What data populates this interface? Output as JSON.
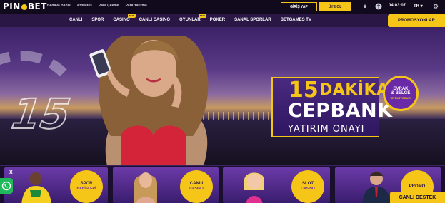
{
  "brand": {
    "logo_left": "PIN",
    "logo_right": "BET"
  },
  "top_links": [
    "Bedava Bahis",
    "Affiliates",
    "Para Çekme",
    "Para Yatırma"
  ],
  "auth": {
    "login": "GİRİŞ YAP",
    "register": "ÜYE OL"
  },
  "status": {
    "clock": "04:03:07",
    "lang": "TR"
  },
  "nav": [
    {
      "label": "CANLI",
      "badge": ""
    },
    {
      "label": "SPOR",
      "badge": ""
    },
    {
      "label": "CASINO",
      "badge": "NEW"
    },
    {
      "label": "CANLI CASINO",
      "badge": ""
    },
    {
      "label": "OYUNLAR",
      "badge": "NEW"
    },
    {
      "label": "POKER",
      "badge": ""
    },
    {
      "label": "SANAL SPORLAR",
      "badge": ""
    },
    {
      "label": "BETGAMES TV",
      "badge": ""
    }
  ],
  "promo_button": "PROMOSYONLAR",
  "hero": {
    "counter_digit": "15",
    "headline_number": "15",
    "headline_word": "DAKİKA",
    "brand_word": "CEPBANK",
    "sub": "YATIRIM ONAYI",
    "evrak_line1": "EVRAK",
    "evrak_line2": "& BELGE",
    "evrak_line3": "İSTEMİYORUZ!"
  },
  "cards": [
    {
      "line1": "SPOR",
      "line2": "BAHİSLERİ"
    },
    {
      "line1": "CANLI",
      "line2": "CASINO"
    },
    {
      "line1": "SLOT",
      "line2": "CASINO"
    },
    {
      "line1": "PROMO",
      "line2": ""
    }
  ],
  "close_label": "X",
  "support": "CANLI DESTEK",
  "colors": {
    "accent": "#f5c518",
    "bg": "#1a0f2e",
    "nav": "#2a1746",
    "purple": "#6a2aa8"
  },
  "icons": [
    "star-icon",
    "help-icon",
    "settings-icon",
    "whatsapp-icon"
  ]
}
